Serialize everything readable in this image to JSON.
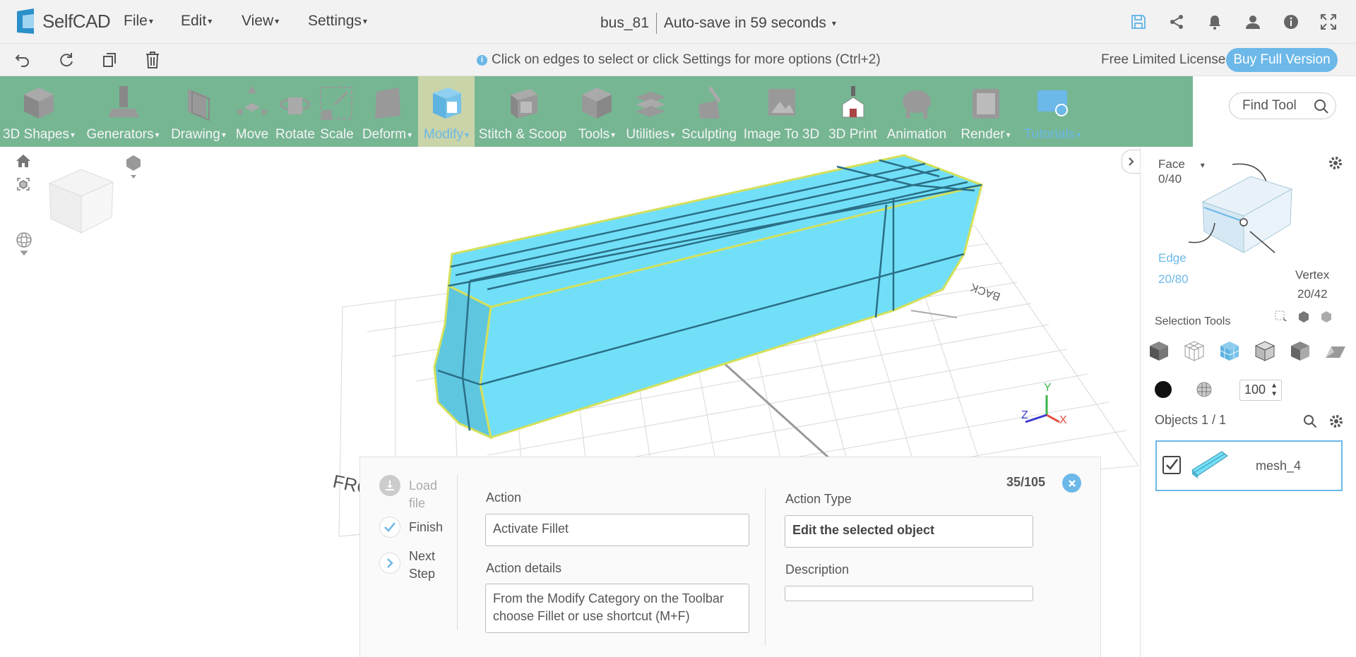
{
  "app": {
    "name": "SelfCAD"
  },
  "menu": {
    "file": "File",
    "edit": "Edit",
    "view": "View",
    "settings": "Settings"
  },
  "project": {
    "name": "bus_81",
    "autosave": "Auto-save in 59 seconds"
  },
  "hint": "Click on edges to select or click Settings for more options (Ctrl+2)",
  "license": {
    "label": "Free Limited License",
    "buy": "Buy Full Version"
  },
  "toolbar": [
    {
      "label": "3D Shapes",
      "dropdown": true,
      "icon": "cube-icon"
    },
    {
      "label": "Generators",
      "dropdown": true,
      "icon": "generator-icon"
    },
    {
      "label": "Drawing",
      "dropdown": true,
      "icon": "drawing-icon"
    },
    {
      "label": "Move",
      "dropdown": false,
      "icon": "move-icon"
    },
    {
      "label": "Rotate",
      "dropdown": false,
      "icon": "rotate-icon"
    },
    {
      "label": "Scale",
      "dropdown": false,
      "icon": "scale-icon"
    },
    {
      "label": "Deform",
      "dropdown": true,
      "icon": "deform-icon"
    },
    {
      "label": "Modify",
      "dropdown": true,
      "icon": "modify-icon",
      "active": true
    },
    {
      "label": "Stitch & Scoop",
      "dropdown": false,
      "icon": "stitch-scoop-icon"
    },
    {
      "label": "Tools",
      "dropdown": true,
      "icon": "tools-icon"
    },
    {
      "label": "Utilities",
      "dropdown": true,
      "icon": "utilities-icon"
    },
    {
      "label": "Sculpting",
      "dropdown": false,
      "icon": "sculpting-icon"
    },
    {
      "label": "Image To 3D",
      "dropdown": false,
      "icon": "image-to-3d-icon"
    },
    {
      "label": "3D Print",
      "dropdown": false,
      "icon": "3d-print-icon"
    },
    {
      "label": "Animation",
      "dropdown": false,
      "icon": "animation-icon"
    },
    {
      "label": "Render",
      "dropdown": true,
      "icon": "render-icon"
    },
    {
      "label": "Tutorials",
      "dropdown": true,
      "icon": "tutorials-icon",
      "tutorial": true
    }
  ],
  "findtool": {
    "placeholder": "Find Tool"
  },
  "selection": {
    "face_label": "Face",
    "face_count": "0/40",
    "edge_label": "Edge",
    "edge_count": "20/80",
    "vertex_label": "Vertex",
    "vertex_count": "20/42",
    "tools_label": "Selection Tools",
    "opacity": "100"
  },
  "objects": {
    "title": "Objects 1 / 1",
    "items": [
      {
        "name": "mesh_4",
        "checked": true
      }
    ]
  },
  "viewport": {
    "label_front": "FRONT",
    "label_back": "BACK",
    "axis_x": "X",
    "axis_y": "Y",
    "axis_z": "Z"
  },
  "step": {
    "counter": "35/105",
    "load_file": "Load file",
    "finish": "Finish",
    "next": "Next Step",
    "action_label": "Action",
    "action_value": "Activate Fillet",
    "details_label": "Action details",
    "details_value": "From the Modify Category on the Toolbar choose Fillet or use shortcut (M+F)",
    "type_label": "Action Type",
    "type_value": "Edit the selected object",
    "description_label": "Description",
    "description_value": ""
  },
  "colors": {
    "toolbar": "#76b693",
    "accent": "#6cb8e8",
    "mesh": "#72dff8",
    "mesh_edge": "#d4e05a"
  }
}
